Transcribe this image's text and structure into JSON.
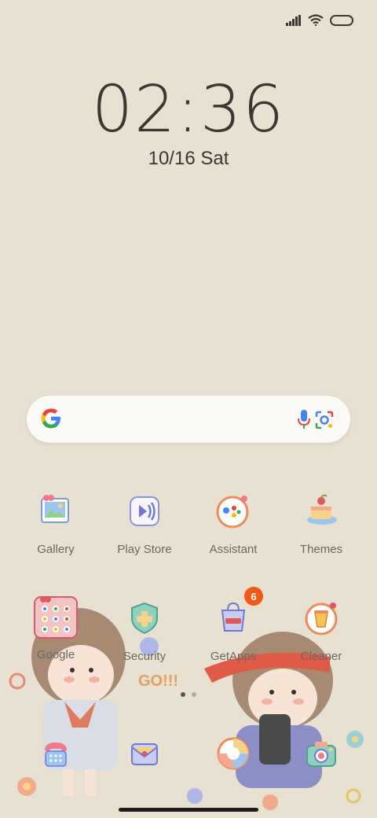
{
  "clock": {
    "time": "02:36",
    "date": "10/16",
    "day": "Sat"
  },
  "search": {
    "engine": "google-logo",
    "mic": "mic-icon",
    "lens": "lens-icon"
  },
  "apps_row1": [
    {
      "label": "Gallery",
      "icon": "gallery-icon"
    },
    {
      "label": "Play Store",
      "icon": "play-store-icon"
    },
    {
      "label": "Assistant",
      "icon": "assistant-icon"
    },
    {
      "label": "Themes",
      "icon": "themes-icon"
    }
  ],
  "apps_row2": [
    {
      "label": "Google",
      "icon": "google-folder-icon"
    },
    {
      "label": "Security",
      "icon": "security-icon"
    },
    {
      "label": "GetApps",
      "icon": "getapps-icon",
      "badge": "6"
    },
    {
      "label": "Cleaner",
      "icon": "cleaner-icon"
    }
  ],
  "dock": [
    {
      "icon": "phone-icon"
    },
    {
      "icon": "messages-icon"
    },
    {
      "icon": "browser-icon"
    },
    {
      "icon": "camera-icon"
    }
  ],
  "wallpaper_text": "GO!!!",
  "colors": {
    "background": "#e8e1d2",
    "badge": "#f05a16",
    "text": "#3a3733"
  }
}
